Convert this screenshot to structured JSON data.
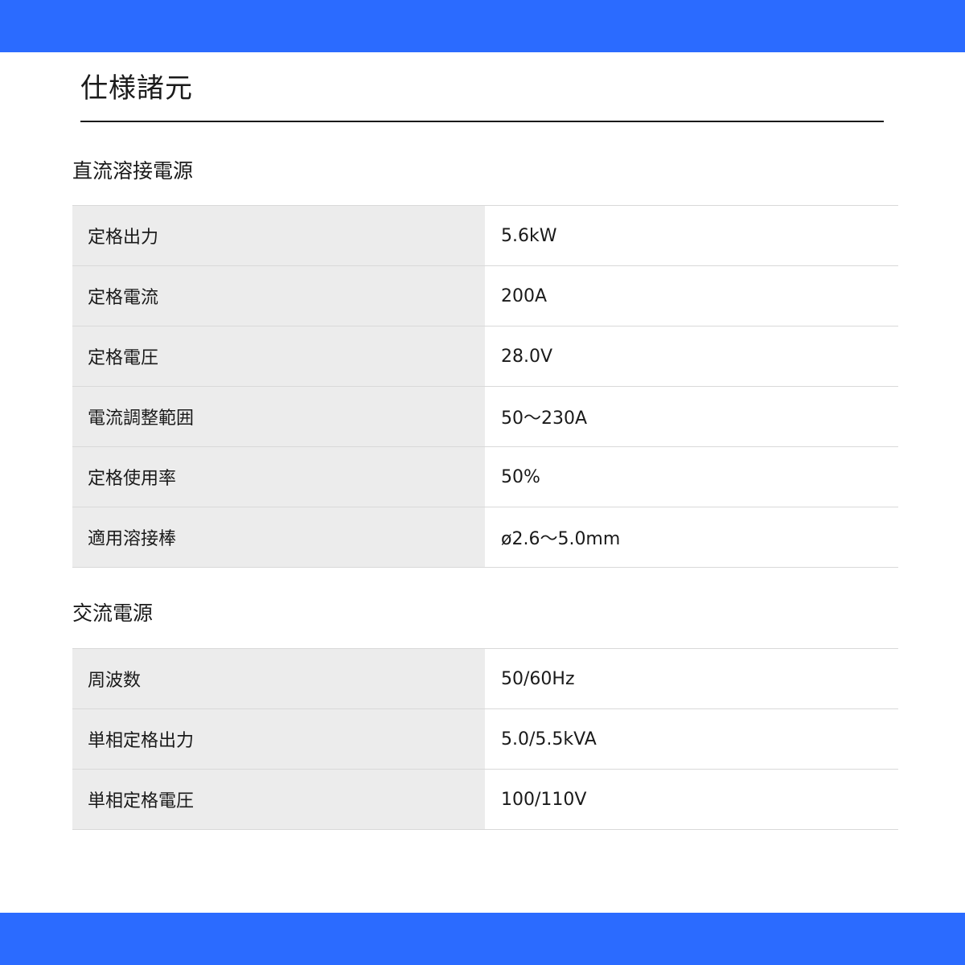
{
  "colors": {
    "band": "#2b6bff",
    "label_bg": "#ececec",
    "rule": "#d9d9d9",
    "text": "#1a1a1a"
  },
  "page": {
    "title": "仕様諸元"
  },
  "sections": [
    {
      "heading": "直流溶接電源",
      "rows": [
        {
          "label": "定格出力",
          "value": "5.6kW"
        },
        {
          "label": "定格電流",
          "value": "200A"
        },
        {
          "label": "定格電圧",
          "value": "28.0V"
        },
        {
          "label": "電流調整範囲",
          "value": "50～230A"
        },
        {
          "label": "定格使用率",
          "value": "50%"
        },
        {
          "label": "適用溶接棒",
          "value": "ø2.6～5.0mm"
        }
      ]
    },
    {
      "heading": "交流電源",
      "rows": [
        {
          "label": "周波数",
          "value": "50/60Hz"
        },
        {
          "label": "単相定格出力",
          "value": "5.0/5.5kVA"
        },
        {
          "label": "単相定格電圧",
          "value": "100/110V"
        }
      ]
    }
  ]
}
